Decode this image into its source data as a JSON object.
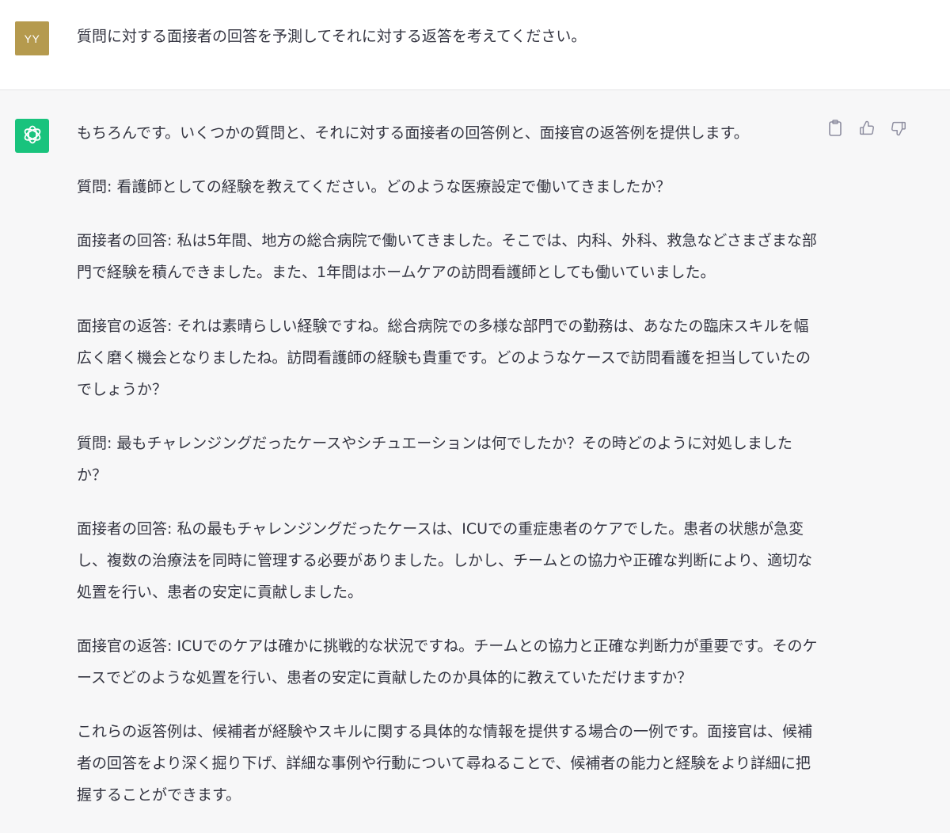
{
  "user": {
    "avatar_initials": "YY",
    "message": "質問に対する面接者の回答を予測してそれに対する返答を考えてください。"
  },
  "assistant": {
    "paragraphs": [
      "もちろんです。いくつかの質問と、それに対する面接者の回答例と、面接官の返答例を提供します。",
      "質問: 看護師としての経験を教えてください。どのような医療設定で働いてきましたか？",
      "面接者の回答: 私は5年間、地方の総合病院で働いてきました。そこでは、内科、外科、救急などさまざまな部門で経験を積んできました。また、1年間はホームケアの訪問看護師としても働いていました。",
      "面接官の返答: それは素晴らしい経験ですね。総合病院での多様な部門での勤務は、あなたの臨床スキルを幅広く磨く機会となりましたね。訪問看護師の経験も貴重です。どのようなケースで訪問看護を担当していたのでしょうか？",
      "質問: 最もチャレンジングだったケースやシチュエーションは何でしたか？その時どのように対処しましたか？",
      "面接者の回答: 私の最もチャレンジングだったケースは、ICUでの重症患者のケアでした。患者の状態が急変し、複数の治療法を同時に管理する必要がありました。しかし、チームとの協力や正確な判断により、適切な処置を行い、患者の安定に貢献しました。",
      "面接官の返答: ICUでのケアは確かに挑戦的な状況ですね。チームとの協力と正確な判断力が重要です。そのケースでどのような処置を行い、患者の安定に貢献したのか具体的に教えていただけますか？",
      "これらの返答例は、候補者が経験やスキルに関する具体的な情報を提供する場合の一例です。面接官は、候補者の回答をより深く掘り下げ、詳細な事例や行動について尋ねることで、候補者の能力と経験をより詳細に把握することができます。"
    ]
  },
  "icons": {
    "assistant_avatar": "openai-logo-icon",
    "copy": "clipboard-icon",
    "like": "thumbs-up-icon",
    "dislike": "thumbs-down-icon"
  },
  "colors": {
    "user_avatar_bg": "#b59a4e",
    "assistant_avatar_bg": "#19c37d",
    "user_row_bg": "#ffffff",
    "assistant_row_bg": "#f7f7f8"
  }
}
